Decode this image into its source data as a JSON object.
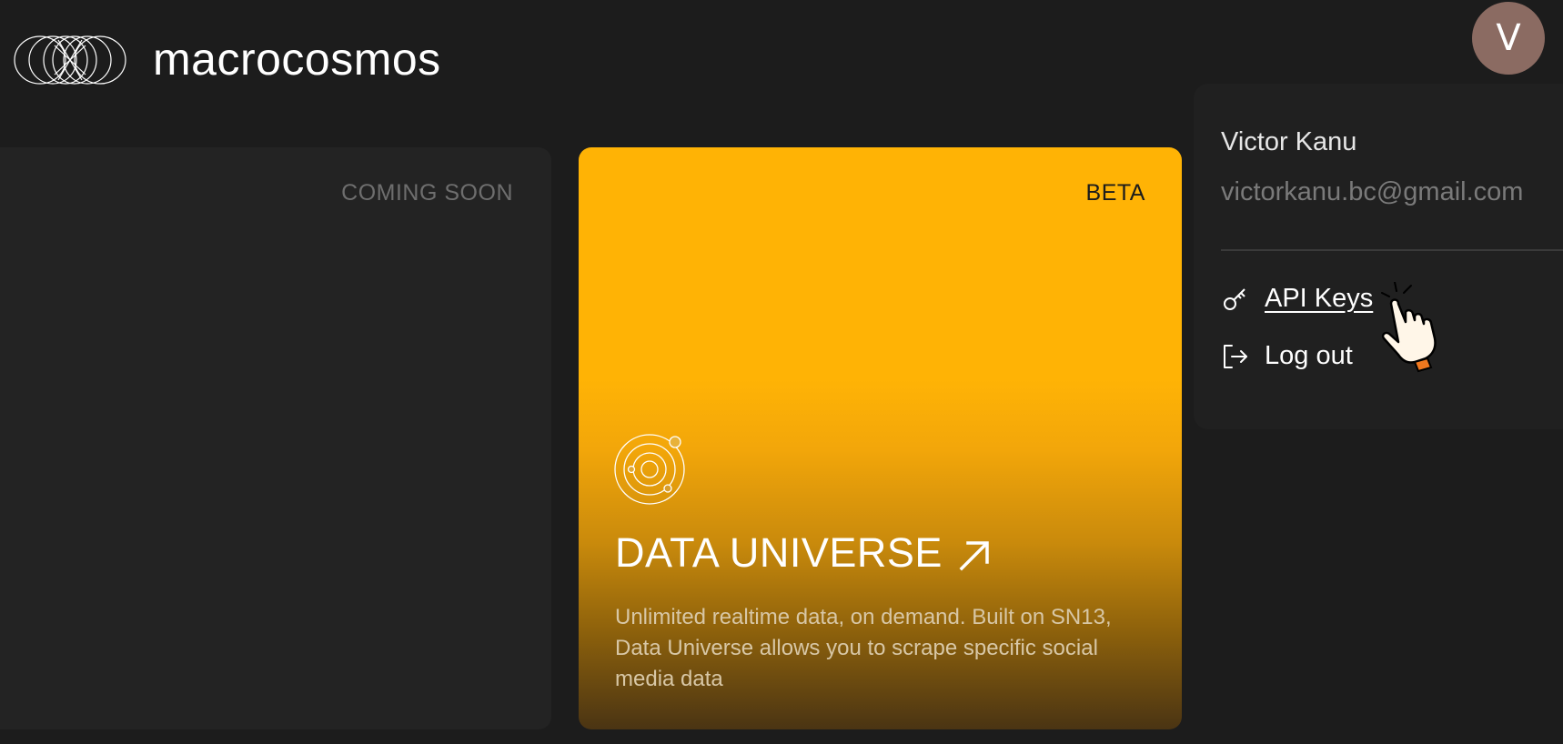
{
  "header": {
    "brand": "macrocosmos",
    "logo_icon": "macrocosmos-rings-logo",
    "avatar_initial": "V"
  },
  "cards": {
    "left": {
      "status": "COMING SOON"
    },
    "main": {
      "status": "BETA",
      "title": "DATA UNIVERSE",
      "icon": "orbit-icon",
      "link_icon": "arrow-up-right-icon",
      "description": "Unlimited realtime data, on demand. Built on SN13, Data Universe allows you to scrape specific social media data",
      "accent_color": "#ffb305"
    }
  },
  "user_menu": {
    "name": "Victor Kanu",
    "email": "victorkanu.bc@gmail.com",
    "items": [
      {
        "label": "API Keys",
        "icon": "key-icon"
      },
      {
        "label": "Log out",
        "icon": "logout-icon"
      }
    ]
  }
}
